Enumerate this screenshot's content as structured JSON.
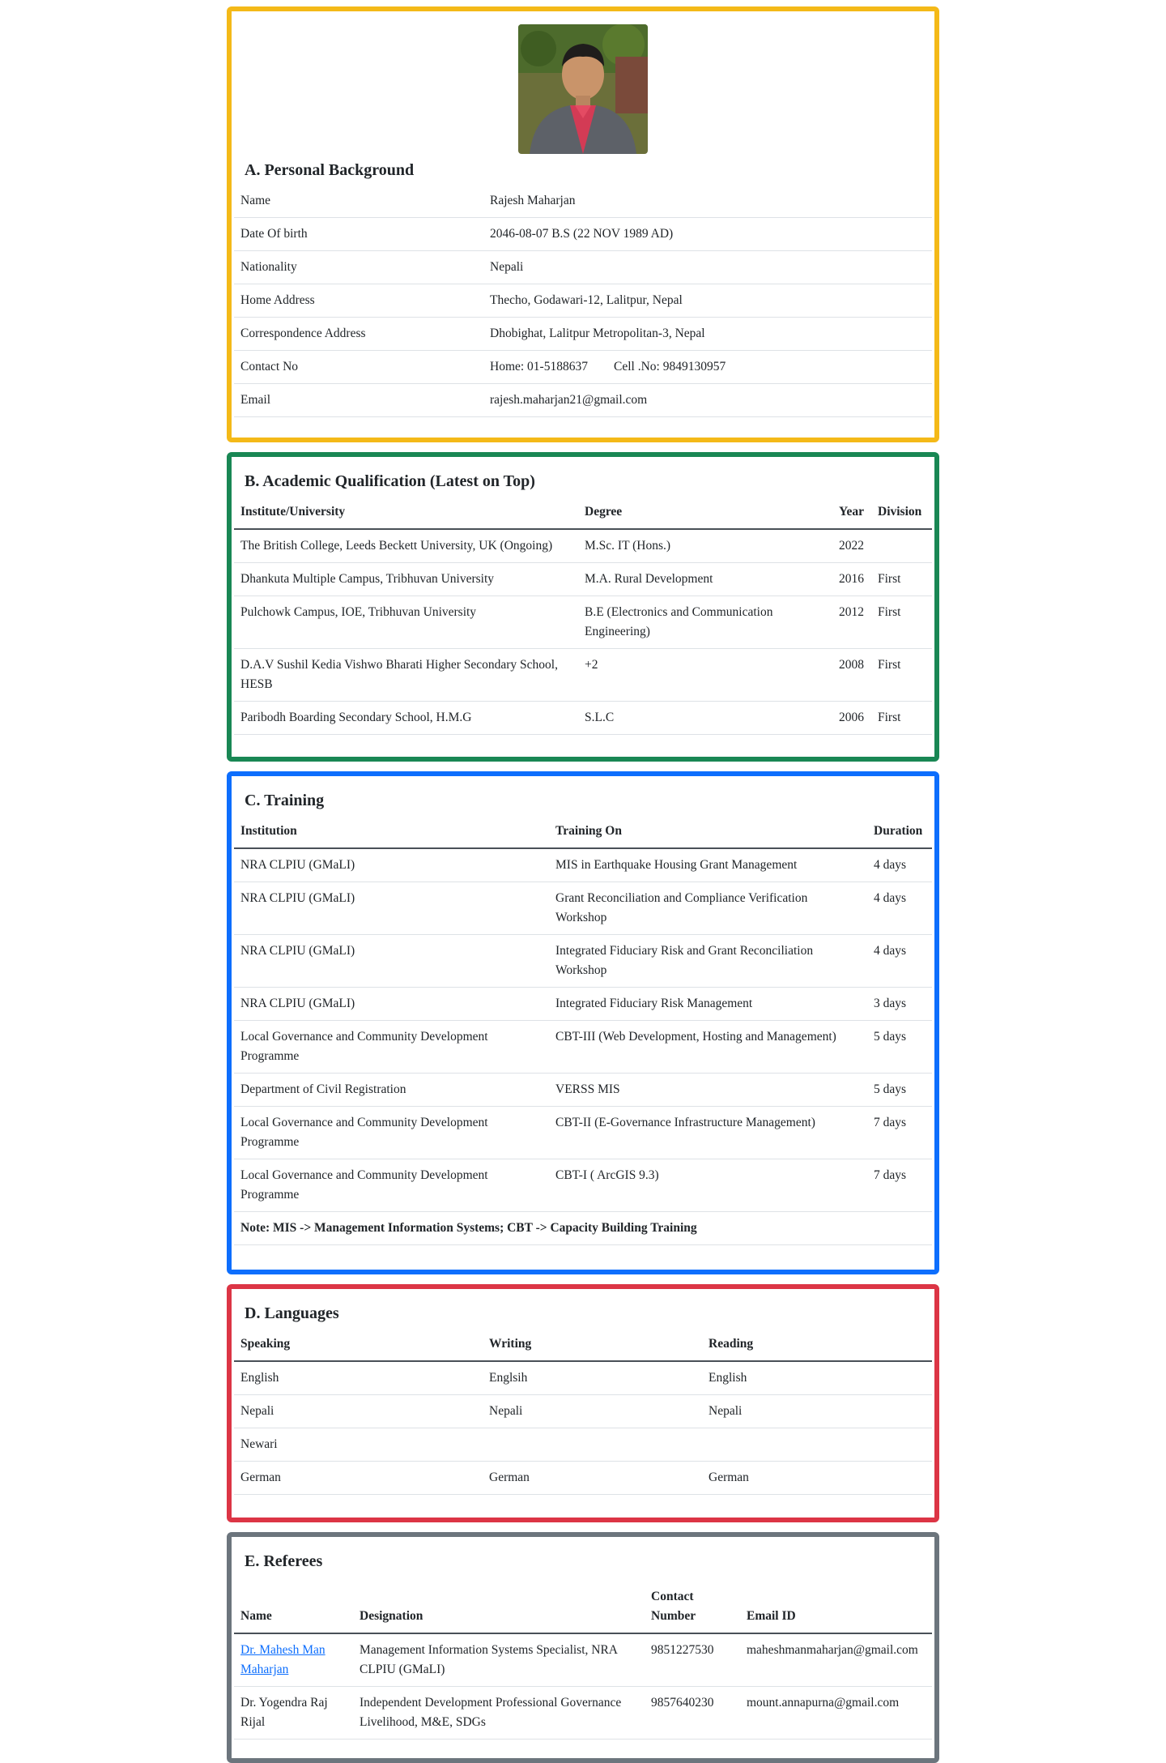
{
  "colors": {
    "personal": "#f4b918",
    "academic": "#198754",
    "training": "#0d6efd",
    "languages": "#dc3545",
    "referees": "#6c757d"
  },
  "personal": {
    "title": "A. Personal Background",
    "photo_icon": "profile-photo",
    "rows": [
      {
        "label": "Name",
        "value": "Rajesh Maharjan"
      },
      {
        "label": "Date Of birth",
        "value": "2046-08-07 B.S (22 NOV 1989 AD)"
      },
      {
        "label": "Nationality",
        "value": "Nepali"
      },
      {
        "label": "Home Address",
        "value": "Thecho, Godawari-12, Lalitpur, Nepal"
      },
      {
        "label": "Correspondence Address",
        "value": "Dhobighat, Lalitpur Metropolitan-3, Nepal"
      },
      {
        "label": "Contact No",
        "value": "Home: 01-5188637",
        "value2": "Cell .No: 9849130957"
      },
      {
        "label": "Email",
        "value": "rajesh.maharjan21@gmail.com"
      }
    ]
  },
  "academic": {
    "title": "B. Academic Qualification (Latest on Top)",
    "headers": [
      "Institute/University",
      "Degree",
      "Year",
      "Division"
    ],
    "rows": [
      {
        "institute": "The British College, Leeds Beckett University, UK (Ongoing)",
        "degree": "M.Sc. IT (Hons.)",
        "year": "2022",
        "division": ""
      },
      {
        "institute": "Dhankuta Multiple Campus, Tribhuvan University",
        "degree": "M.A. Rural Development",
        "year": "2016",
        "division": "First"
      },
      {
        "institute": "Pulchowk Campus, IOE, Tribhuvan University",
        "degree": "B.E (Electronics and Communication Engineering)",
        "year": "2012",
        "division": "First"
      },
      {
        "institute": "D.A.V Sushil Kedia Vishwo Bharati Higher Secondary School, HESB",
        "degree": "+2",
        "year": "2008",
        "division": "First"
      },
      {
        "institute": "Paribodh Boarding Secondary School, H.M.G",
        "degree": "S.L.C",
        "year": "2006",
        "division": "First"
      }
    ]
  },
  "training": {
    "title": "C. Training",
    "headers": [
      "Institution",
      "Training On",
      "Duration"
    ],
    "rows": [
      {
        "institution": "NRA CLPIU (GMaLI)",
        "topic": "MIS in Earthquake Housing Grant Management",
        "duration": "4 days"
      },
      {
        "institution": "NRA CLPIU (GMaLI)",
        "topic": "Grant Reconciliation and Compliance Verification Workshop",
        "duration": "4 days"
      },
      {
        "institution": "NRA CLPIU (GMaLI)",
        "topic": "Integrated Fiduciary Risk and Grant Reconciliation Workshop",
        "duration": "4 days"
      },
      {
        "institution": "NRA CLPIU (GMaLI)",
        "topic": "Integrated Fiduciary Risk Management",
        "duration": "3 days"
      },
      {
        "institution": "Local Governance and Community Development Programme",
        "topic": "CBT-III (Web Development, Hosting and Management)",
        "duration": "5 days"
      },
      {
        "institution": "Department of Civil Registration",
        "topic": "VERSS MIS",
        "duration": "5 days"
      },
      {
        "institution": "Local Governance and Community Development Programme",
        "topic": "CBT-II (E-Governance Infrastructure Management)",
        "duration": "7 days"
      },
      {
        "institution": "Local Governance and Community Development Programme",
        "topic": "CBT-I ( ArcGIS 9.3)",
        "duration": "7 days"
      }
    ],
    "note": "Note: MIS -> Management Information Systems; CBT -> Capacity Building Training"
  },
  "languages": {
    "title": "D. Languages",
    "headers": [
      "Speaking",
      "Writing",
      "Reading"
    ],
    "rows": [
      {
        "speaking": "English",
        "writing": "Englsih",
        "reading": "English"
      },
      {
        "speaking": "Nepali",
        "writing": "Nepali",
        "reading": "Nepali"
      },
      {
        "speaking": "Newari",
        "writing": "",
        "reading": ""
      },
      {
        "speaking": "German",
        "writing": "German",
        "reading": "German"
      }
    ]
  },
  "referees": {
    "title": "E. Referees",
    "headers": [
      "Name",
      "Designation",
      "Contact Number",
      "Email ID"
    ],
    "rows": [
      {
        "name": "Dr. Mahesh Man Maharjan",
        "designation": "Management Information Systems Specialist, NRA CLPIU (GMaLI)",
        "contact": "9851227530",
        "email": "maheshmanmaharjan@gmail.com",
        "link": true
      },
      {
        "name": "Dr. Yogendra Raj Rijal",
        "designation": "Independent Development Professional Governance Livelihood, M&E, SDGs",
        "contact": "9857640230",
        "email": "mount.annapurna@gmail.com",
        "link": false
      }
    ]
  }
}
